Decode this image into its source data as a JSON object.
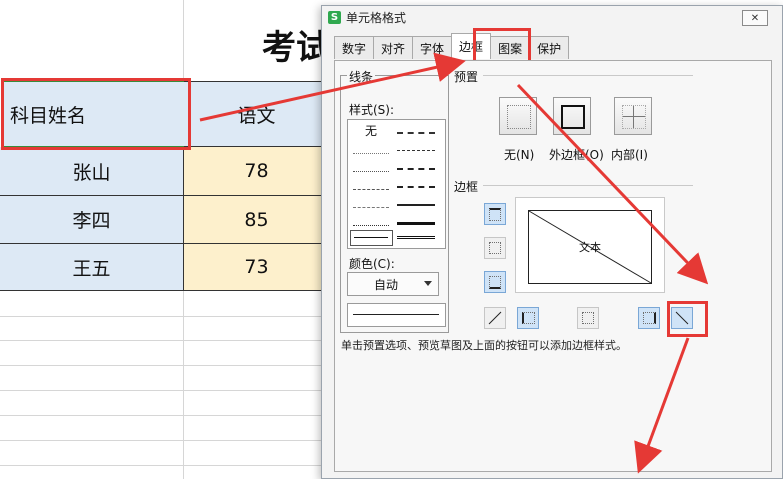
{
  "sheet": {
    "title": "考试",
    "header_name": "科目姓名",
    "header_chinese": "语文",
    "rows": [
      {
        "name": "张山",
        "score": "78"
      },
      {
        "name": "李四",
        "score": "85"
      },
      {
        "name": "王五",
        "score": "73"
      }
    ]
  },
  "dialog": {
    "title": "单元格格式",
    "close_icon": "close-icon",
    "tabs": [
      "数字",
      "对齐",
      "字体",
      "边框",
      "图案",
      "保护"
    ],
    "active_tab": "边框",
    "line_group": "线条",
    "style_label": "样式(S):",
    "style_none": "无",
    "color_label": "颜色(C):",
    "color_value": "自动",
    "preset_group": "预置",
    "preset_none": "无(N)",
    "preset_outline": "外边框(O)",
    "preset_inside": "内部(I)",
    "border_group": "边框",
    "preview_text": "文本",
    "hint": "单击预置选项、预览草图及上面的按钮可以添加边框样式。"
  },
  "colors": {
    "highlight": "#e53935",
    "header_fill": "#dde9f5",
    "score_fill": "#fdf0cc",
    "accent_button": "#cfe3f7"
  }
}
